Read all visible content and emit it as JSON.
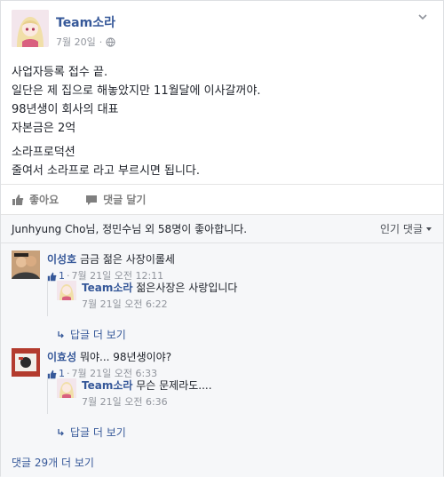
{
  "post": {
    "author": "Team소라",
    "date": "7월 20일",
    "privacy_icon": "globe-icon",
    "lines": [
      "사업자등록 접수 끝.",
      "일단은 제 집으로 해놓았지만 11월달에 이사갈꺼야.",
      "98년생이 회사의 대표",
      "자본금은 2억",
      "",
      "소라프로덕션",
      "줄여서 소라프로 라고 부르시면 됩니다."
    ]
  },
  "actions": {
    "like": "좋아요",
    "comment": "댓글 달기"
  },
  "feedback": {
    "likers": "Junhyung Cho님, 정민수님 외 58명이 좋아합니다.",
    "sort": "인기 댓글",
    "view_more": "댓글 29개 더 보기"
  },
  "comments": [
    {
      "author": "이성호",
      "text": "금금 젊은 사장이롤세",
      "likes": "1",
      "time": "7월 21일 오전 12:11",
      "reply": {
        "author": "Team소라",
        "text": "젊은사장은 사랑입니다",
        "time": "7월 21일 오전 6:22"
      },
      "more": "답글 더 보기"
    },
    {
      "author": "이효성",
      "text": "뭐야... 98년생이야?",
      "likes": "1",
      "time": "7월 21일 오전 6:33",
      "reply": {
        "author": "Team소라",
        "text": "무슨 문제라도....",
        "time": "7월 21일 오전 6:36"
      },
      "more": "답글 더 보기"
    }
  ],
  "colors": {
    "link": "#365899",
    "muted": "#90949c",
    "feedback_bg": "#f6f7f9"
  }
}
